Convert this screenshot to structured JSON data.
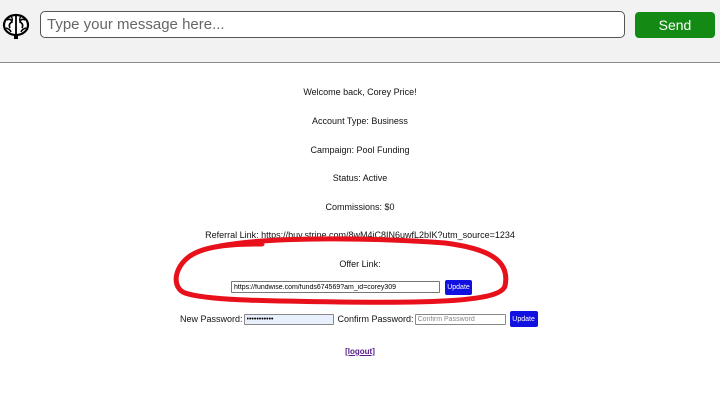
{
  "header": {
    "logo_icon": "brain-icon",
    "message_placeholder": "Type your message here...",
    "send_label": "Send",
    "send_color": "#138a13"
  },
  "account": {
    "welcome": "Welcome back, Corey Price!",
    "account_type": "Account Type: Business",
    "campaign": "Campaign: Pool Funding",
    "status": "Status: Active",
    "commissions": "Commissions: $0",
    "referral": "Referral Link: https://buy.stripe.com/8wM4jC8IN6uwfL2bIK?utm_source=1234"
  },
  "offer": {
    "label": "Offer Link:",
    "value": "https://fundwise.com/funds674569?am_id=corey309",
    "update_label": "Update"
  },
  "password": {
    "new_label": "New Password:",
    "new_value": "•••••••••••",
    "confirm_label": "Confirm Password:",
    "confirm_placeholder": "Confirm Password",
    "update_label": "Update"
  },
  "logout_label": "[logout]",
  "colors": {
    "button_blue": "#1010e0",
    "annotation_red": "#e8111b",
    "logout_link": "#551a8b"
  }
}
